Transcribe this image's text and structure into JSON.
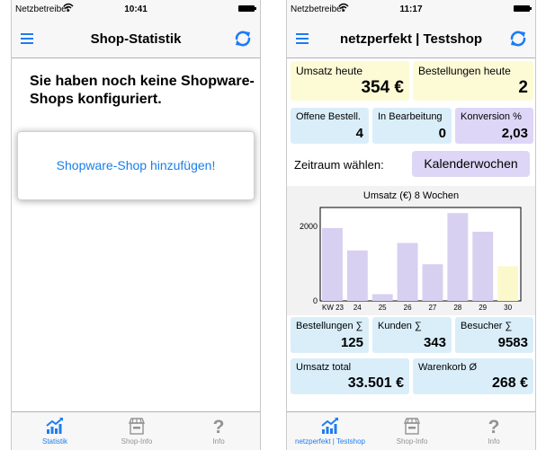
{
  "left_screen": {
    "status": {
      "carrier": "Netzbetreiber",
      "time": "10:41"
    },
    "nav": {
      "title": "Shop-Statistik"
    },
    "message": "Sie haben noch keine Shopware-Shops konfiguriert.",
    "add_button": "Shopware-Shop hinzufügen!",
    "tabs": [
      {
        "label": "Statistik",
        "icon": "chart-icon",
        "active": true
      },
      {
        "label": "Shop-Info",
        "icon": "shop-icon",
        "active": false
      },
      {
        "label": "Info",
        "icon": "question-icon",
        "active": false
      }
    ]
  },
  "right_screen": {
    "status": {
      "carrier": "Netzbetreiber",
      "time": "11:17"
    },
    "nav": {
      "title": "netzperfekt | Testshop"
    },
    "tiles": {
      "umsatz_heute": {
        "label": "Umsatz heute",
        "value": "354 €"
      },
      "bestellungen_heute": {
        "label": "Bestellungen heute",
        "value": "2"
      },
      "offene_bestell": {
        "label": "Offene Bestell.",
        "value": "4"
      },
      "in_bearbeitung": {
        "label": "In Bearbeitung",
        "value": "0"
      },
      "konversion": {
        "label": "Konversion %",
        "value": "2,03"
      },
      "bestellungen_sum": {
        "label": "Bestellungen ∑",
        "value": "125"
      },
      "kunden_sum": {
        "label": "Kunden ∑",
        "value": "343"
      },
      "besucher_sum": {
        "label": "Besucher ∑",
        "value": "9583"
      },
      "umsatz_total": {
        "label": "Umsatz total",
        "value": "33.501 €"
      },
      "warenkorb": {
        "label": "Warenkorb Ø",
        "value": "268 €"
      }
    },
    "zeitraum": {
      "label": "Zeitraum wählen:",
      "button": "Kalenderwochen"
    },
    "tabs": [
      {
        "label": "netzperfekt | Testshop",
        "icon": "chart-icon",
        "active": true
      },
      {
        "label": "Shop-Info",
        "icon": "shop-icon",
        "active": false
      },
      {
        "label": "Info",
        "icon": "question-icon",
        "active": false
      }
    ]
  },
  "colors": {
    "accent": "#1e7cf2",
    "bar": "#d8d0f0",
    "bar_current": "#fbf9cc"
  },
  "chart_data": {
    "type": "bar",
    "title": "Umsatz (€) 8 Wochen",
    "categories": [
      "KW 23",
      "24",
      "25",
      "26",
      "27",
      "28",
      "29",
      "30"
    ],
    "values": [
      1950,
      1350,
      180,
      1550,
      980,
      2350,
      1850,
      930
    ],
    "highlight_last": true,
    "y_ticks": [
      0,
      2000
    ],
    "ylim": [
      0,
      2500
    ],
    "grid": false
  }
}
